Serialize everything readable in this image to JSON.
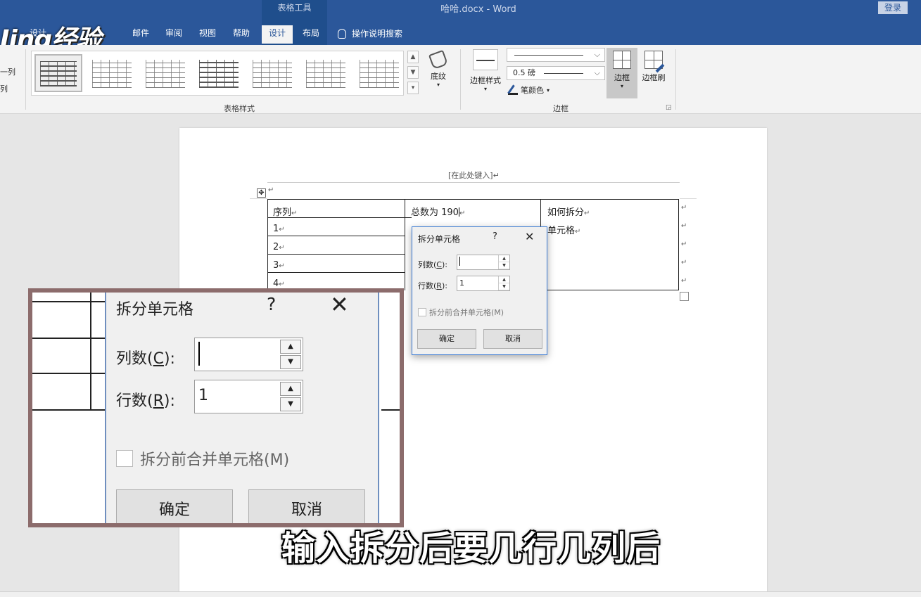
{
  "window": {
    "context_group": "表格工具",
    "doc_title": "哈哈.docx - Word",
    "login": "登录"
  },
  "tabs": [
    {
      "label": "设计",
      "active": false
    },
    {
      "label": "邮件",
      "active": false
    },
    {
      "label": "审阅",
      "active": false
    },
    {
      "label": "视图",
      "active": false
    },
    {
      "label": "帮助",
      "active": false
    },
    {
      "label": "设计",
      "active": true
    },
    {
      "label": "布局",
      "active": false
    }
  ],
  "search": {
    "label": "操作说明搜索",
    "icon": "lightbulb-icon"
  },
  "watermark": "Jing经验",
  "ribbon": {
    "left_cut": [
      "一列",
      "列"
    ],
    "table_styles_label": "表格样式",
    "shading": "底纹",
    "border_styles": "边框样式",
    "line_weight": "0.5 磅",
    "pen_color": "笔颜色",
    "borders": "边框",
    "border_painter": "边框刷",
    "borders_group_label": "边框"
  },
  "document": {
    "header_placeholder": "[在此处键入]",
    "para_mark": "↵",
    "table": {
      "header": [
        "序列",
        "总数为 190",
        "如何拆分"
      ],
      "col3_line2": "单元格",
      "rows": [
        "1",
        "2",
        "3",
        "4"
      ]
    }
  },
  "dialog": {
    "title": "拆分单元格",
    "help": "?",
    "cols_label_prefix": "列数(",
    "cols_key": "C",
    "rows_label_prefix": "行数(",
    "rows_key": "R",
    "label_suffix": "):",
    "cols_value": "",
    "rows_value": "1",
    "merge_label": "拆分前合并单元格(M)",
    "merge_checked": false,
    "ok": "确定",
    "cancel": "取消"
  },
  "subtitle": "输入拆分后要几行几列后"
}
